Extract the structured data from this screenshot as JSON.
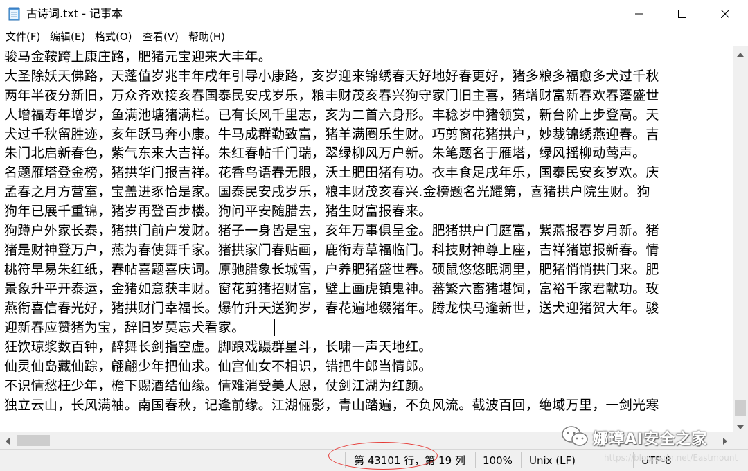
{
  "window": {
    "title": "古诗词.txt - 记事本"
  },
  "menu": {
    "items": [
      "文件(F)",
      "编辑(E)",
      "格式(O)",
      "查看(V)",
      "帮助(H)"
    ]
  },
  "editor": {
    "lines": [
      "骏马金鞍跨上康庄路，肥猪元宝迎来大丰年。",
      "大圣除妖天佛路，天蓬值岁兆丰年戌年引导小康路，亥岁迎来锦绣春天好地好春更好，猪多粮多福愈多犬过千秋",
      "两年半夜分新旧，万众齐欢接亥春国泰民安戌岁乐，粮丰财茂亥春兴狗守家门旧主喜，猪增财富新春欢春蓬盛世",
      "人增福寿年增岁，鱼满池塘猪满栏。已有长风千里志，亥为二首六身形。丰稔岁中猪领赏，新台阶上步登高。天",
      "犬过千秋留胜迹，亥年跃马奔小康。牛马成群勤致富，猪羊满圈乐生财。巧剪窗花猪拱户，妙裁锦绣燕迎春。吉",
      "朱门北启新春色，紫气东来大吉祥。朱红春帖千门瑞，翠绿柳风万户新。朱笔题名于雁塔，绿风摇柳动莺声。",
      "名题雁塔登金榜，猪拱华门报吉祥。花香鸟语春无限，沃土肥田猪有功。衣丰食足戌年乐，国泰民安亥岁欢。庆",
      "孟春之月方营室，宝盖进豕恰是家。国泰民安戌岁乐，粮丰财茂亥春兴.金榜题名光耀第，喜猪拱户院生财。狗",
      "狗年已展千重锦，猪岁再登百步楼。狗问平安随腊去，猪生财富报春来。",
      "狗蹲户外家长泰，猪拱门前户发财。猪子一身皆是宝，亥年万事俱呈金。肥猪拱户门庭富，紫燕报春岁月新。猪",
      "猪是财神登万户，燕为春使舞千家。猪拱家门春贴画，鹿衔寿草福临门。科技财神尊上座，吉祥猪崽报新春。情",
      "桃符早易朱红纸，春帖喜题喜庆词。原驰腊象长城雪，户养肥猪盛世春。硕鼠悠悠眠洞里，肥猪悄悄拱门来。肥",
      "景象升平开泰运，金猪如意获丰财。窗花剪猪招财富，壁上画虎镇鬼神。蕃繁六畜猪堪饲，富裕千家君献功。玫",
      "燕衔喜信春光好，猪拱财门幸福长。爆竹升天送狗岁，春花遍地缀猪年。腾龙快马逢新世，送犬迎猪贺大年。骏",
      "迎新春应赞猪为宝，辞旧岁莫忘犬看家。",
      "狂饮琼浆数百钟，醉舞长剑指空虚。脚踉戏蹑群星斗，长啸一声天地红。",
      "仙灵仙岛藏仙踪，翩翩少年把仙求。仙宫仙女不相识，错把牛郎当情郎。",
      "不识情愁枉少年，檐下赐酒结仙缘。情难消受美人恩，仗剑江湖为红颜。",
      "独立云山，长风满袖。南国春秋，记逢前缘。江湖俪影，青山踏遍，不负风流。截波百回，绝域万里，一剑光寒"
    ]
  },
  "status": {
    "position": "第 43101 行，第 19 列",
    "zoom": "100%",
    "line_ending": "Unix (LF)",
    "encoding": "UTF-8"
  },
  "watermark": {
    "text": "娜璋AI安全之家",
    "url": "https://blog.csdn.net/Eastmount"
  },
  "colors": {
    "highlight": "#e53935"
  },
  "icons": {
    "app": "notepad-icon",
    "minimize": "minimize-icon",
    "maximize": "maximize-icon",
    "close": "close-icon",
    "watermark": "wechat-icon"
  }
}
